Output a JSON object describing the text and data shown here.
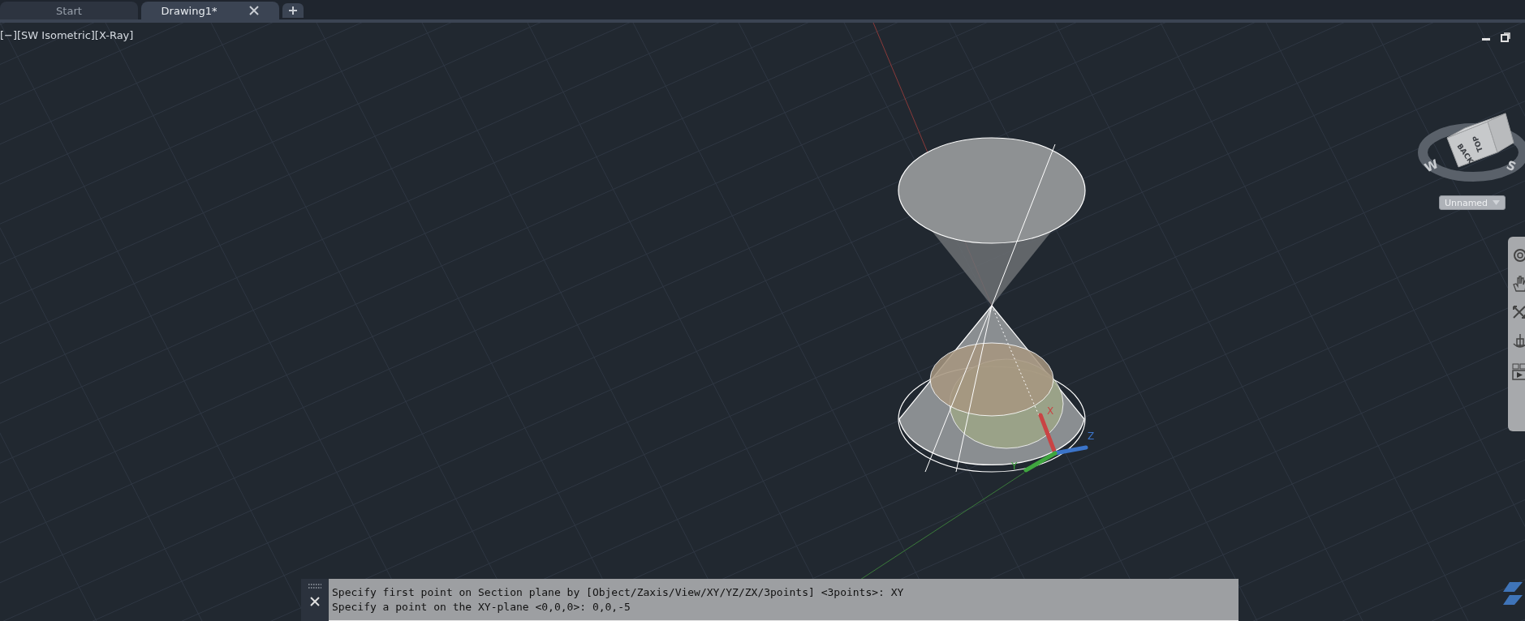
{
  "tabs": [
    {
      "label": "Start",
      "selected": false
    },
    {
      "label": "Drawing1*",
      "selected": true,
      "closable": true
    }
  ],
  "viewport": {
    "controls": [
      {
        "label": "[−]"
      },
      {
        "label": "[SW Isometric]"
      },
      {
        "label": "[X-Ray]"
      }
    ],
    "viewcube": {
      "faces": [
        "BACK",
        "TOP"
      ],
      "compass": [
        "W",
        "S"
      ],
      "ucs_menu": "Unnamed"
    },
    "ucs_axes": [
      "X",
      "Y",
      "Z"
    ]
  },
  "command_line": {
    "history": [
      "Specify first point on Section plane by [Object/Zaxis/View/XY/YZ/ZX/3points] <3points>: XY",
      "Specify a point on the XY-plane <0,0,0>: 0,0,-5"
    ]
  }
}
